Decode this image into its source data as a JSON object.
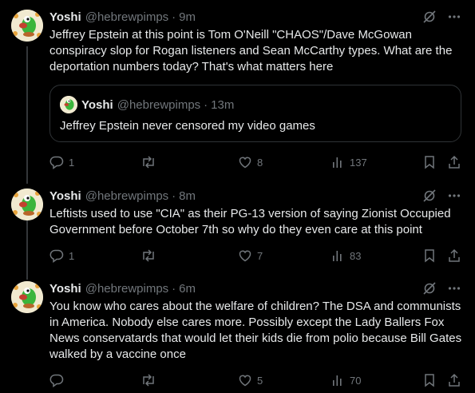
{
  "posts": [
    {
      "name": "Yoshi",
      "handle": "@hebrewpimps",
      "dot": "·",
      "time": "9m",
      "text": "Jeffrey Epstein at this point is Tom O'Neill \"CHAOS\"/Dave McGowan conspiracy slop for Rogan listeners and Sean McCarthy types. What are the deportation numbers today? That's what matters here",
      "quote": {
        "name": "Yoshi",
        "handle": "@hebrewpimps",
        "dot": "·",
        "time": "13m",
        "text": "Jeffrey Epstein never censored my video games"
      },
      "replies": "1",
      "reposts": "",
      "likes": "8",
      "views": "137"
    },
    {
      "name": "Yoshi",
      "handle": "@hebrewpimps",
      "dot": "·",
      "time": "8m",
      "text": "Leftists used to use \"CIA\" as their PG-13 version of saying Zionist Occupied Government before October 7th so why do they even care at this point",
      "replies": "1",
      "reposts": "",
      "likes": "7",
      "views": "83"
    },
    {
      "name": "Yoshi",
      "handle": "@hebrewpimps",
      "dot": "·",
      "time": "6m",
      "text": "You know who cares about the welfare of children? The DSA and communists in America. Nobody else cares more. Possibly except the Lady Ballers Fox News conservatards that would let their kids die from polio because Bill Gates walked by a vaccine once",
      "replies": "",
      "reposts": "",
      "likes": "5",
      "views": "70"
    }
  ],
  "icons": {
    "grok": "grok-icon",
    "more": "more-icon",
    "reply": "reply-icon",
    "repost": "repost-icon",
    "like": "heart-icon",
    "views": "views-icon",
    "bookmark": "bookmark-icon",
    "share": "share-icon"
  },
  "colors": {
    "background": "#000000",
    "text": "#e7e9ea",
    "muted": "#71767b",
    "border": "#2f3336",
    "avatar_green": "#3bb53b"
  }
}
